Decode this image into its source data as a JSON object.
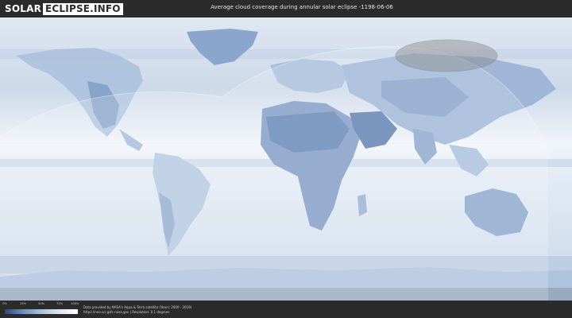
{
  "header": {
    "logo_part1": "SOLAR",
    "logo_part2": "ECLIPSE.INFO",
    "title": "Average cloud coverage during annular solar eclipse -1198-06-06"
  },
  "legend": {
    "ticks": [
      "0%",
      "25%",
      "50%",
      "75%",
      "100%"
    ],
    "gradient": [
      "#2a4a78",
      "#6b8fbd",
      "#a9c1dd",
      "#dfe8f3",
      "#ffffff"
    ]
  },
  "credits": {
    "line1": "Data provided by NASA's Aqua & Terra satellite (Years: 2000 - 2019)",
    "line2": "https://neo.sci.gsfc.nasa.gov | Resolution: 0.1 degrees"
  },
  "colors": {
    "background": "#2b2b2b",
    "ocean_cloud": "#e8eef6",
    "clear_land": "#7f9cc6",
    "eclipse_shadow": "#8a8a8a"
  }
}
